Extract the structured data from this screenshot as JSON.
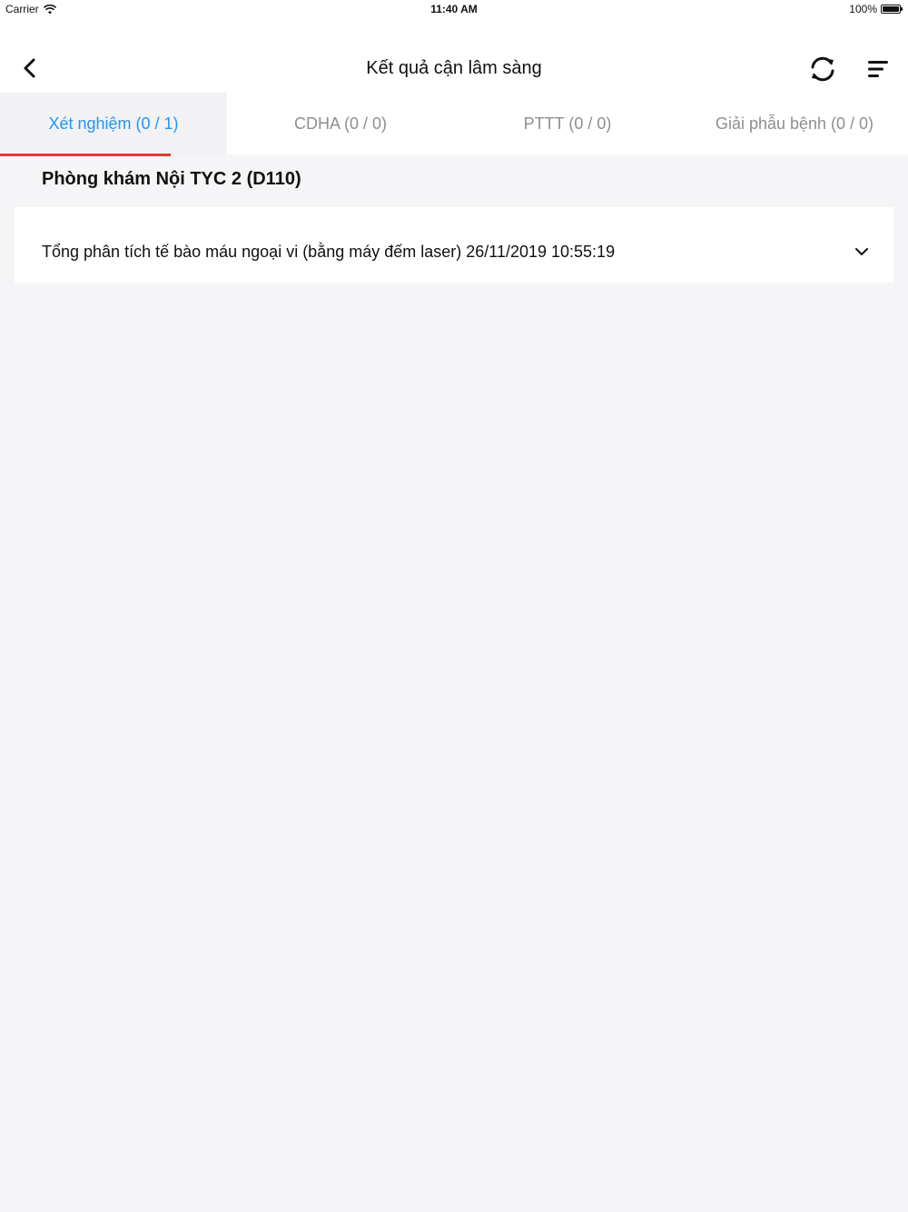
{
  "status_bar": {
    "carrier": "Carrier",
    "time": "11:40 AM",
    "battery": "100%",
    "battery_level": 1.0
  },
  "navbar": {
    "title": "Kết quả cận lâm sàng",
    "back_icon": "chevron-left-icon",
    "refresh_icon": "refresh-icon",
    "menu_icon": "menu-icon"
  },
  "tabs": [
    {
      "label": "Xét nghiệm (0 / 1)",
      "active": true
    },
    {
      "label": "CDHA (0 / 0)",
      "active": false
    },
    {
      "label": "PTTT (0 / 0)",
      "active": false
    },
    {
      "label": "Giải phẫu bệnh (0 / 0)",
      "active": false
    }
  ],
  "section": {
    "title": "Phòng khám Nội TYC 2 (D110)",
    "items": [
      {
        "label": "Tổng phân tích tế bào máu ngoại vi (bằng máy đếm laser) 26/11/2019 10:55:19"
      }
    ]
  },
  "colors": {
    "active_tab_text": "#2196f3",
    "tab_indicator": "#e53935",
    "inactive_tab_text": "#8e8e93",
    "background": "#f5f5f7"
  }
}
